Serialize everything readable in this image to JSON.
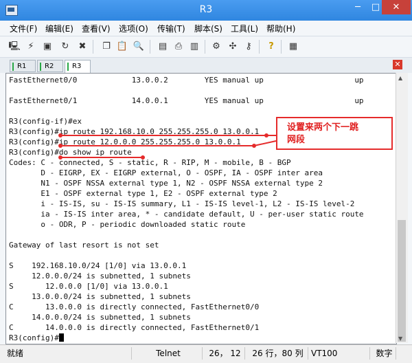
{
  "window": {
    "title": "R3",
    "min": "─",
    "max": "□",
    "close": "✕"
  },
  "menu": [
    {
      "label": "文件(F)"
    },
    {
      "label": "编辑(E)"
    },
    {
      "label": "查看(V)"
    },
    {
      "label": "选项(O)"
    },
    {
      "label": "传输(T)"
    },
    {
      "label": "脚本(S)"
    },
    {
      "label": "工具(L)"
    },
    {
      "label": "帮助(H)"
    }
  ],
  "toolbar_icons": [
    "connect-icon",
    "quick-connect-icon",
    "connect-tab-icon",
    "reconnect-icon",
    "disconnect-icon",
    "copy-icon",
    "paste-icon",
    "find-icon",
    "print-setup-icon",
    "print-icon",
    "print-screen-icon",
    "session-options-icon",
    "global-options-icon",
    "keymap-icon",
    "help-icon",
    "sftp-icon"
  ],
  "tabs": [
    {
      "label": "R1"
    },
    {
      "label": "R2"
    },
    {
      "label": "R3"
    }
  ],
  "terminal_lines": [
    "FastEthernet0/0            13.0.0.2        YES manual up                    up",
    "",
    "FastEthernet0/1            14.0.0.1        YES manual up                    up",
    "",
    "R3(config-if)#ex",
    "R3(config)#ip route 192.168.10.0 255.255.255.0 13.0.0.1",
    "R3(config)#ip route 12.0.0.0 255.255.255.0 13.0.0.1",
    "R3(config)#do show ip route",
    "Codes: C - connected, S - static, R - RIP, M - mobile, B - BGP",
    "       D - EIGRP, EX - EIGRP external, O - OSPF, IA - OSPF inter area",
    "       N1 - OSPF NSSA external type 1, N2 - OSPF NSSA external type 2",
    "       E1 - OSPF external type 1, E2 - OSPF external type 2",
    "       i - IS-IS, su - IS-IS summary, L1 - IS-IS level-1, L2 - IS-IS level-2",
    "       ia - IS-IS inter area, * - candidate default, U - per-user static route",
    "       o - ODR, P - periodic downloaded static route",
    "",
    "Gateway of last resort is not set",
    "",
    "S    192.168.10.0/24 [1/0] via 13.0.0.1",
    "     12.0.0.0/24 is subnetted, 1 subnets",
    "S       12.0.0.0 [1/0] via 13.0.0.1",
    "     13.0.0.0/24 is subnetted, 1 subnets",
    "C       13.0.0.0 is directly connected, FastEthernet0/0",
    "     14.0.0.0/24 is subnetted, 1 subnets",
    "C       14.0.0.0 is directly connected, FastEthernet0/1",
    "R3(config)#"
  ],
  "annotation": {
    "line1": "设置来两个下一跳",
    "line2": "网段",
    "color": "#e52b2b"
  },
  "status": {
    "ready": "就绪",
    "protocol": "Telnet",
    "position": "26， 12",
    "size": "26 行，80 列",
    "terminal": "VT100",
    "mode": "数字"
  }
}
